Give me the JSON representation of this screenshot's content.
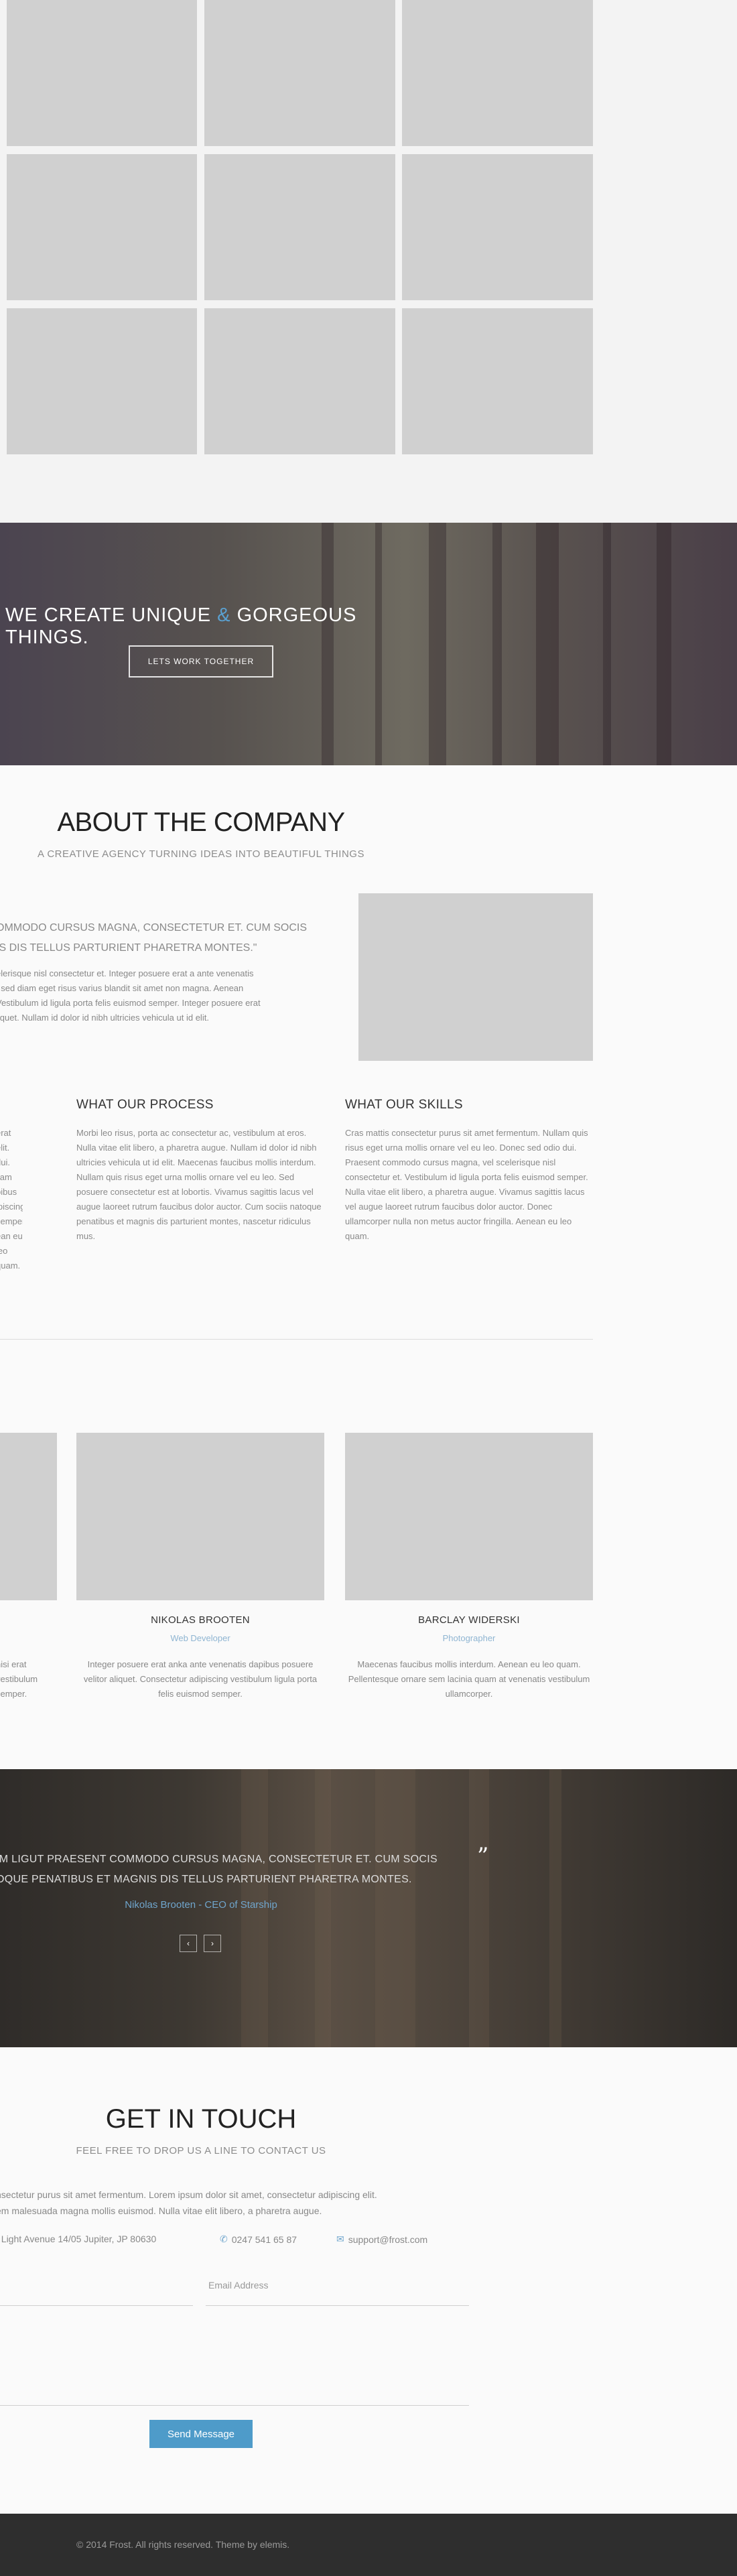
{
  "hero": {
    "title_part1": "WE CREATE UNIQUE",
    "title_amp": "&",
    "title_part2": "GORGEOUS THINGS.",
    "button_label": "LETS WORK TOGETHER",
    "accent_color": "#5aa0d0"
  },
  "about": {
    "title": "ABOUT THE COMPANY",
    "subtitle": "A CREATIVE AGENCY TURNING IDEAS INTO BEAUTIFUL THINGS",
    "quote_line1": "OMMODO CURSUS MAGNA, CONSECTETUR ET. CUM SOCIS",
    "quote_line2": "IS DIS TELLUS PARTURIENT PHARETRA MONTES.\"",
    "text_line1": "elerisque nisl consectetur et. Integer posuere erat a ante venenatis",
    "text_line2": ". sed diam eget risus varius blandit sit amet non magna. Aenean",
    "text_line3": "Vestibulum id ligula porta felis euismod semper. Integer posuere erat",
    "text_line4": "liquet. Nullam id dolor id nibh ultricies vehicula ut id elit.",
    "columns": [
      {
        "title": "",
        "text": "erat\nelit.\ndui.\nllam\npibus\nipiscing\nsemper.\nean eu leo\nquam."
      },
      {
        "title": "WHAT OUR PROCESS",
        "text": "Morbi leo risus, porta ac consectetur ac, vestibulum at eros. Nulla vitae elit libero, a pharetra augue. Nullam id dolor id nibh ultricies vehicula ut id elit. Maecenas faucibus mollis interdum. Nullam quis risus eget urna mollis ornare vel eu leo. Sed posuere consectetur est at lobortis. Vivamus sagittis lacus vel augue laoreet rutrum faucibus dolor auctor. Cum sociis natoque penatibus et magnis dis parturient montes, nascetur ridiculus mus."
      },
      {
        "title": "WHAT OUR SKILLS",
        "text": "Cras mattis consectetur purus sit amet fermentum. Nullam quis risus eget urna mollis ornare vel eu leo. Donec sed odio dui. Praesent commodo cursus magna, vel scelerisque nisl consectetur et. Vestibulum id ligula porta felis euismod semper. Nulla vitae elit libero, a pharetra augue. Vivamus sagittis lacus vel augue laoreet rutrum faucibus dolor auctor. Donec ullamcorper nulla non metus auctor fringilla. Aenean eu leo quam."
      }
    ]
  },
  "team": [
    {
      "name": "",
      "role": "",
      "text": "nisi erat\nvestibulum\nsemper."
    },
    {
      "name": "NIKOLAS BROOTEN",
      "role": "Web Developer",
      "text": "Integer posuere erat anka ante venenatis dapibus posuere velitor aliquet. Consectetur adipiscing vestibulum ligula porta felis euismod semper."
    },
    {
      "name": "BARCLAY WIDERSKI",
      "role": "Photographer",
      "text": "Maecenas faucibus mollis interdum. Aenean eu leo quam. Pellentesque ornare sem lacinia quam at venenatis vestibulum ullamcorper."
    }
  ],
  "testimonial": {
    "quote_line1": "IM LIGUT PRAESENT COMMODO CURSUS MAGNA, CONSECTETUR ET. CUM SOCIS",
    "quote_line2": "OQUE PENATIBUS ET MAGNIS DIS TELLUS PARTURIENT PHARETRA MONTES.",
    "quote_mark": "”",
    "author": "Nikolas Brooten - CEO of Starship",
    "prev_icon": "‹",
    "next_icon": "›"
  },
  "contact": {
    "title": "GET IN TOUCH",
    "subtitle": "FEEL FREE TO DROP US A LINE TO CONTACT US",
    "text_line1": "nsectetur purus sit amet fermentum. Lorem ipsum dolor sit amet, consectetur adipiscing elit.",
    "text_line2": "em malesuada magna mollis euismod. Nulla vitae elit libero, a pharetra augue.",
    "address": "t Light Avenue 14/05 Jupiter, JP 80630",
    "phone": "0247 541 65 87",
    "phone_icon": "✆",
    "email": "support@frost.com",
    "email_icon": "✉",
    "email_placeholder": "Email Address",
    "send_label": "Send Message",
    "button_color": "#4e9bc9"
  },
  "footer": {
    "text": "© 2014 Frost. All rights reserved. Theme by elemis."
  }
}
